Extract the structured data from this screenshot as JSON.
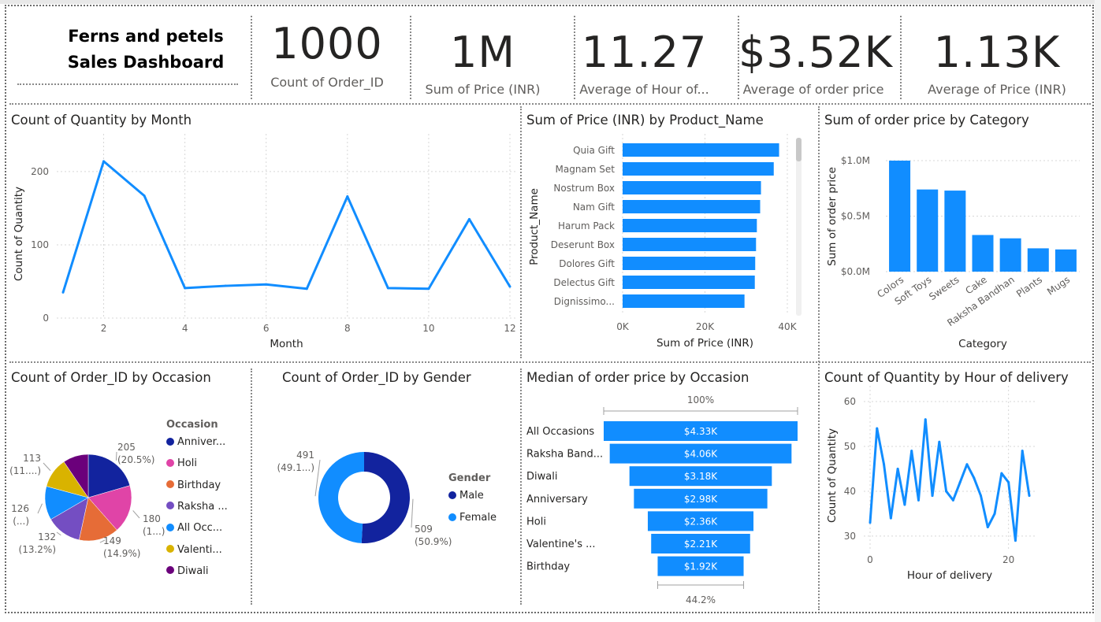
{
  "header": {
    "title_line1": "Ferns and petels",
    "title_line2": "Sales Dashboard"
  },
  "kpis": [
    {
      "value": "1000",
      "label": "Count of Order_ID"
    },
    {
      "value": "1M",
      "label": "Sum of Price (INR)"
    },
    {
      "value": "11.27",
      "label": "Average of Hour of..."
    },
    {
      "value": "$3.52K",
      "label": "Average of order price"
    },
    {
      "value": "1.13K",
      "label": "Average of Price (INR)"
    }
  ],
  "colors": {
    "blue": "#118dff",
    "dark_blue": "#12239e",
    "orange": "#e66c37",
    "purple": "#744ec2",
    "pink": "#e044a7",
    "yellow": "#d9b300",
    "dark_purple": "#6b007b"
  },
  "chart_data": [
    {
      "id": "qty_by_month",
      "type": "line",
      "title": "Count of Quantity by Month",
      "xlabel": "Month",
      "ylabel": "Count of Quantity",
      "x": [
        1,
        2,
        3,
        4,
        5,
        6,
        7,
        8,
        9,
        10,
        11,
        12
      ],
      "values": [
        35,
        214,
        167,
        41,
        44,
        46,
        40,
        166,
        41,
        40,
        135,
        43
      ],
      "xticks": [
        "2",
        "4",
        "6",
        "8",
        "10",
        "12"
      ],
      "xtick_values": [
        2,
        4,
        6,
        8,
        10,
        12
      ],
      "yticks": [
        "0",
        "100",
        "200"
      ],
      "ytick_values": [
        0,
        100,
        200
      ],
      "xlim": [
        1,
        12
      ],
      "ylim": [
        0,
        230
      ],
      "grid": true
    },
    {
      "id": "price_by_product",
      "type": "bar",
      "title": "Sum of Price (INR) by Product_Name",
      "xlabel": "Sum of Price (INR)",
      "ylabel": "Product_Name",
      "categories": [
        "Quia Gift",
        "Magnam Set",
        "Nostrum Box",
        "Nam Gift",
        "Harum Pack",
        "Deserunt Box",
        "Dolores Gift",
        "Delectus Gift",
        "Dignissimo..."
      ],
      "values": [
        38000,
        36700,
        33600,
        33400,
        32600,
        32400,
        32200,
        32100,
        29600
      ],
      "xticks": [
        "0K",
        "20K",
        "40K"
      ],
      "xtick_values": [
        0,
        20000,
        40000
      ],
      "xlim": [
        0,
        40000
      ],
      "grid": true
    },
    {
      "id": "orderprice_by_category",
      "type": "bar",
      "title": "Sum of order price by Category",
      "xlabel": "Category",
      "ylabel": "Sum of order price",
      "categories": [
        "Colors",
        "Soft Toys",
        "Sweets",
        "Cake",
        "Raksha Bandhan",
        "Plants",
        "Mugs"
      ],
      "values": [
        1.0,
        0.74,
        0.73,
        0.33,
        0.3,
        0.21,
        0.2
      ],
      "yticks": [
        "$0.0M",
        "$0.5M",
        "$1.0M"
      ],
      "ytick_values": [
        0,
        0.5,
        1.0
      ],
      "ylim": [
        0,
        1.0
      ],
      "grid": true
    },
    {
      "id": "orders_by_occasion",
      "type": "pie",
      "title": "Count of Order_ID by Occasion",
      "legend_title": "Occasion",
      "categories": [
        "Anniver...",
        "Holi",
        "Birthday",
        "Raksha ...",
        "All Occ...",
        "Valenti...",
        "Diwali"
      ],
      "values": [
        205,
        180,
        149,
        132,
        126,
        113,
        95
      ],
      "labels": [
        {
          "line1": "205",
          "line2": "(20.5%)"
        },
        {
          "line1": "180",
          "line2": "(1...)"
        },
        {
          "line1": "149",
          "line2": "(14.9%)"
        },
        {
          "line1": "132",
          "line2": "(13.2%)"
        },
        {
          "line1": "126",
          "line2": "(...)"
        },
        {
          "line1": "113",
          "line2": "(11....)"
        }
      ]
    },
    {
      "id": "orders_by_gender",
      "type": "pie",
      "title": "Count of Order_ID by Gender",
      "legend_title": "Gender",
      "categories": [
        "Male",
        "Female"
      ],
      "values": [
        509,
        491
      ],
      "labels": [
        {
          "line1": "509",
          "line2": "(50.9%)"
        },
        {
          "line1": "491",
          "line2": "(49.1...)"
        }
      ]
    },
    {
      "id": "median_by_occasion",
      "type": "bar",
      "title": "Median of order price by Occasion",
      "categories": [
        "All Occasions",
        "Raksha Band...",
        "Diwali",
        "Anniversary",
        "Holi",
        "Valentine's ...",
        "Birthday"
      ],
      "values": [
        4.33,
        4.06,
        3.18,
        2.98,
        2.36,
        2.21,
        1.92
      ],
      "data_labels": [
        "$4.33K",
        "$4.06K",
        "$3.18K",
        "$2.98K",
        "$2.36K",
        "$2.21K",
        "$1.92K"
      ],
      "top_percent": "100%",
      "bottom_percent": "44.2%"
    },
    {
      "id": "qty_by_hour",
      "type": "line",
      "title": "Count of Quantity by Hour of delivery",
      "xlabel": "Hour of delivery",
      "ylabel": "Count of Quantity",
      "x": [
        0,
        1,
        2,
        3,
        4,
        5,
        6,
        7,
        8,
        9,
        10,
        11,
        12,
        13,
        14,
        15,
        16,
        17,
        18,
        19,
        20,
        21,
        22,
        23
      ],
      "values": [
        33,
        54,
        46,
        34,
        45,
        37,
        49,
        38,
        56,
        39,
        51,
        40,
        38,
        42,
        46,
        43,
        39,
        32,
        35,
        44,
        42,
        29,
        49,
        39
      ],
      "xticks": [
        "0",
        "20"
      ],
      "xtick_values": [
        0,
        20
      ],
      "yticks": [
        "30",
        "40",
        "50",
        "60"
      ],
      "ytick_values": [
        30,
        40,
        50,
        60
      ],
      "xlim": [
        0,
        23
      ],
      "ylim": [
        27,
        60
      ],
      "grid": true
    }
  ]
}
